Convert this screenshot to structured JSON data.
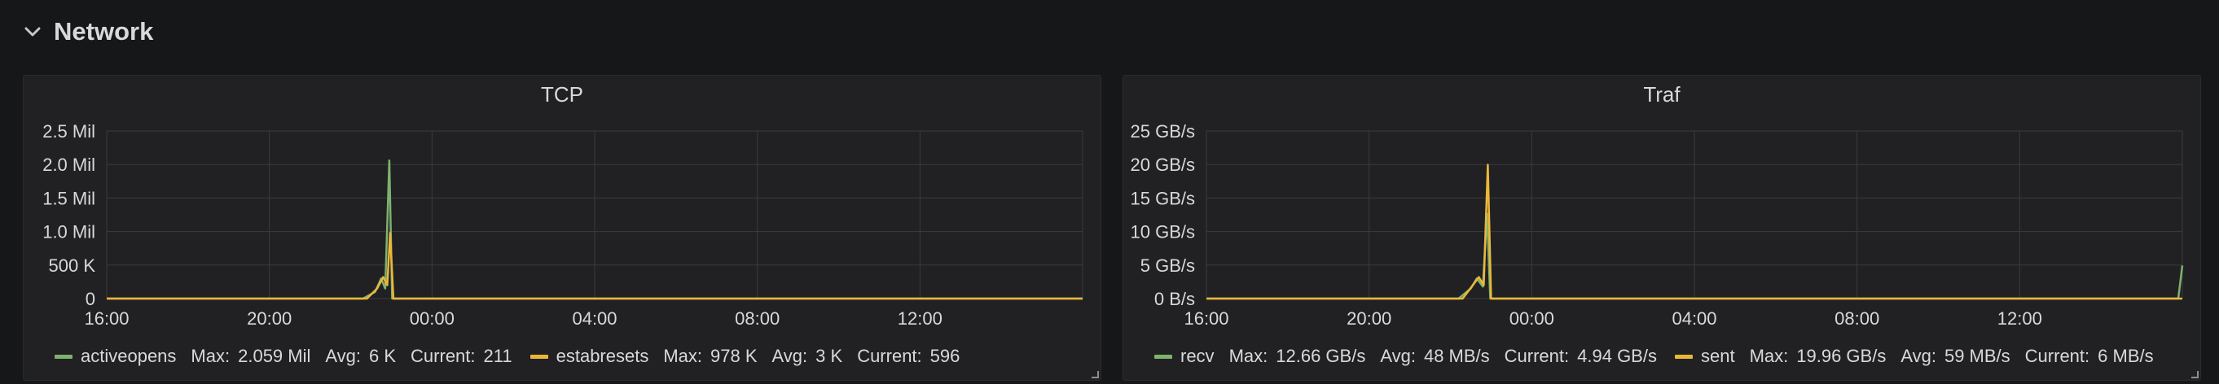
{
  "row": {
    "title": "Network"
  },
  "colors": {
    "green": "#7eb26d",
    "yellow": "#eab839",
    "grid": "#3a3b3e",
    "axis_text": "#d8d9da"
  },
  "panels": [
    {
      "title": "TCP",
      "legend": [
        {
          "name": "activeopens",
          "color": "#7eb26d",
          "max_label": "Max:",
          "max": "2.059 Mil",
          "avg_label": "Avg:",
          "avg": "6 K",
          "current_label": "Current:",
          "current": "211"
        },
        {
          "name": "estabresets",
          "color": "#eab839",
          "max_label": "Max:",
          "max": "978 K",
          "avg_label": "Avg:",
          "avg": "3 K",
          "current_label": "Current:",
          "current": "596"
        }
      ],
      "chart_data": {
        "type": "line",
        "title": "TCP",
        "y_ticks": [
          "0",
          "500 K",
          "1.0 Mil",
          "1.5 Mil",
          "2.0 Mil",
          "2.5 Mil"
        ],
        "ylim": [
          0,
          2500000
        ],
        "x_ticks": [
          "16:00",
          "20:00",
          "00:00",
          "04:00",
          "08:00",
          "12:00"
        ],
        "x_range_hours": [
          16,
          40
        ],
        "series": [
          {
            "name": "activeopens",
            "color": "#7eb26d",
            "points": [
              [
                16,
                0
              ],
              [
                22.3,
                0
              ],
              [
                22.6,
                100000
              ],
              [
                22.75,
                300000
              ],
              [
                22.85,
                150000
              ],
              [
                22.95,
                2059000
              ],
              [
                23.02,
                0
              ],
              [
                40,
                0
              ]
            ]
          },
          {
            "name": "estabresets",
            "color": "#eab839",
            "points": [
              [
                16,
                0
              ],
              [
                22.4,
                0
              ],
              [
                22.65,
                150000
              ],
              [
                22.8,
                320000
              ],
              [
                22.9,
                200000
              ],
              [
                22.97,
                978000
              ],
              [
                23.05,
                0
              ],
              [
                40,
                0
              ]
            ]
          }
        ]
      }
    },
    {
      "title": "Traf",
      "legend": [
        {
          "name": "recv",
          "color": "#7eb26d",
          "max_label": "Max:",
          "max": "12.66 GB/s",
          "avg_label": "Avg:",
          "avg": "48 MB/s",
          "current_label": "Current:",
          "current": "4.94 GB/s"
        },
        {
          "name": "sent",
          "color": "#eab839",
          "max_label": "Max:",
          "max": "19.96 GB/s",
          "avg_label": "Avg:",
          "avg": "59 MB/s",
          "current_label": "Current:",
          "current": "6 MB/s"
        }
      ],
      "chart_data": {
        "type": "line",
        "title": "Traf",
        "y_ticks": [
          "0 B/s",
          "5 GB/s",
          "10 GB/s",
          "15 GB/s",
          "20 GB/s",
          "25 GB/s"
        ],
        "ylim": [
          0,
          25
        ],
        "x_ticks": [
          "16:00",
          "20:00",
          "00:00",
          "04:00",
          "08:00",
          "12:00"
        ],
        "x_range_hours": [
          16,
          40
        ],
        "series": [
          {
            "name": "recv",
            "color": "#7eb26d",
            "points": [
              [
                16,
                0
              ],
              [
                22.2,
                0
              ],
              [
                22.5,
                1.5
              ],
              [
                22.65,
                3
              ],
              [
                22.8,
                1.8
              ],
              [
                22.9,
                12.66
              ],
              [
                22.98,
                0
              ],
              [
                39.9,
                0
              ],
              [
                40,
                4.94
              ]
            ]
          },
          {
            "name": "sent",
            "color": "#eab839",
            "points": [
              [
                16,
                0
              ],
              [
                22.3,
                0
              ],
              [
                22.55,
                2
              ],
              [
                22.7,
                3.2
              ],
              [
                22.82,
                2
              ],
              [
                22.92,
                19.96
              ],
              [
                23.0,
                0
              ],
              [
                39.9,
                0
              ],
              [
                40,
                0.006
              ]
            ]
          }
        ]
      }
    }
  ]
}
